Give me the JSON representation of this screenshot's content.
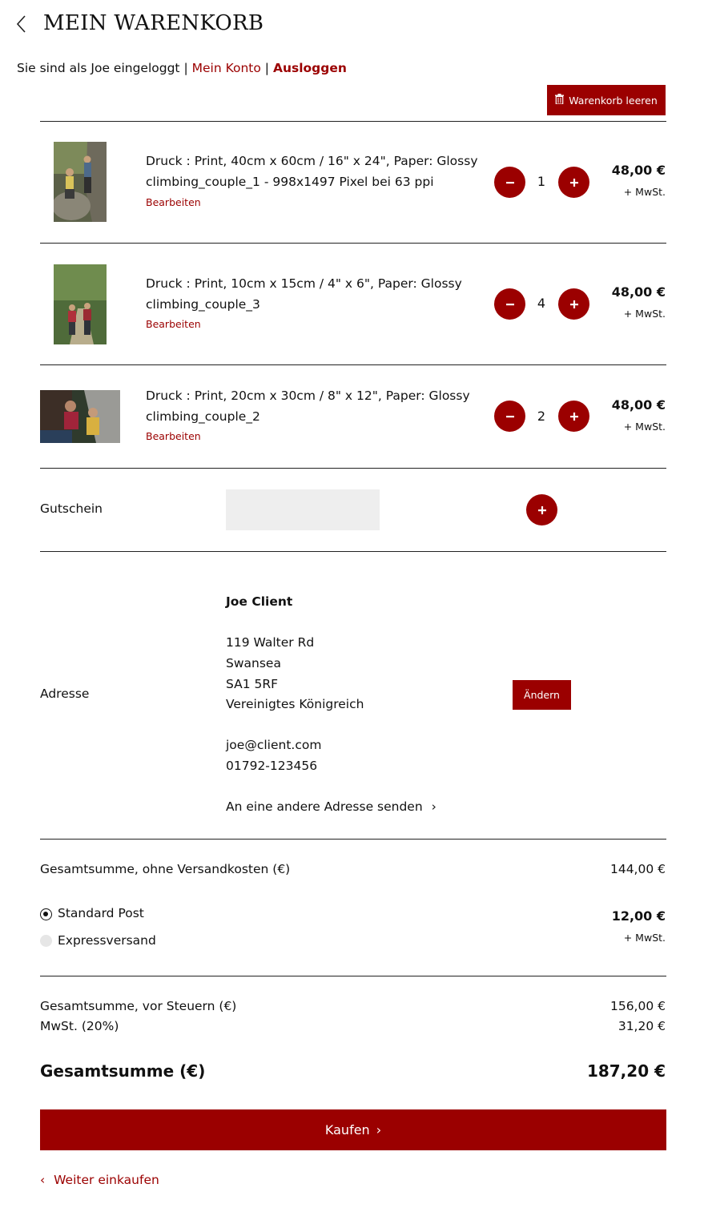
{
  "header": {
    "title": "MEIN WARENKORB",
    "login_prefix": "Sie sind als Joe eingeloggt",
    "separator": "|",
    "account_link": "Mein Konto",
    "logout_link": "Ausloggen"
  },
  "cart": {
    "clear_label": "Warenkorb leeren",
    "edit_label": "Bearbeiten",
    "vat_note": "+ MwSt.",
    "items": [
      {
        "line1": "Druck : Print, 40cm x 60cm / 16\" x 24\", Paper: Glossy",
        "line2": "climbing_couple_1 - 998x1497 Pixel bei 63 ppi",
        "quantity": "1",
        "price": "48,00 €"
      },
      {
        "line1": "Druck : Print, 10cm x 15cm / 4\" x 6\", Paper: Glossy",
        "line2": "climbing_couple_3",
        "quantity": "4",
        "price": "48,00 €"
      },
      {
        "line1": "Druck : Print, 20cm x 30cm / 8\" x 12\", Paper: Glossy",
        "line2": "climbing_couple_2",
        "quantity": "2",
        "price": "48,00 €"
      }
    ]
  },
  "coupon": {
    "label": "Gutschein",
    "value": "",
    "add_label": "+"
  },
  "address": {
    "label": "Adresse",
    "name": "Joe Client",
    "street": "119 Walter Rd",
    "city": "Swansea",
    "postcode": "SA1 5RF",
    "country": "Vereinigtes Königreich",
    "email": "joe@client.com",
    "phone": "01792-123456",
    "other_address_link": "An eine andere Adresse senden",
    "change_label": "Ändern"
  },
  "totals": {
    "subtotal_label": "Gesamtsumme, ohne Versandkosten (€)",
    "subtotal_value": "144,00 €",
    "shipping_options": [
      {
        "label": "Standard Post",
        "selected": true
      },
      {
        "label": "Expressversand",
        "selected": false
      }
    ],
    "shipping_price": "12,00 €",
    "shipping_vat_note": "+ MwSt.",
    "pretax_label": "Gesamtsumme, vor Steuern (€)",
    "pretax_value": "156,00 €",
    "vat_label": "MwSt. (20%)",
    "vat_value": "31,20 €",
    "grand_label": "Gesamtsumme (€)",
    "grand_value": "187,20 €"
  },
  "actions": {
    "buy_label": "Kaufen",
    "continue_label": "Weiter einkaufen"
  },
  "colors": {
    "accent": "#9b0000",
    "text": "#111111",
    "input_bg": "#eeeeee"
  }
}
